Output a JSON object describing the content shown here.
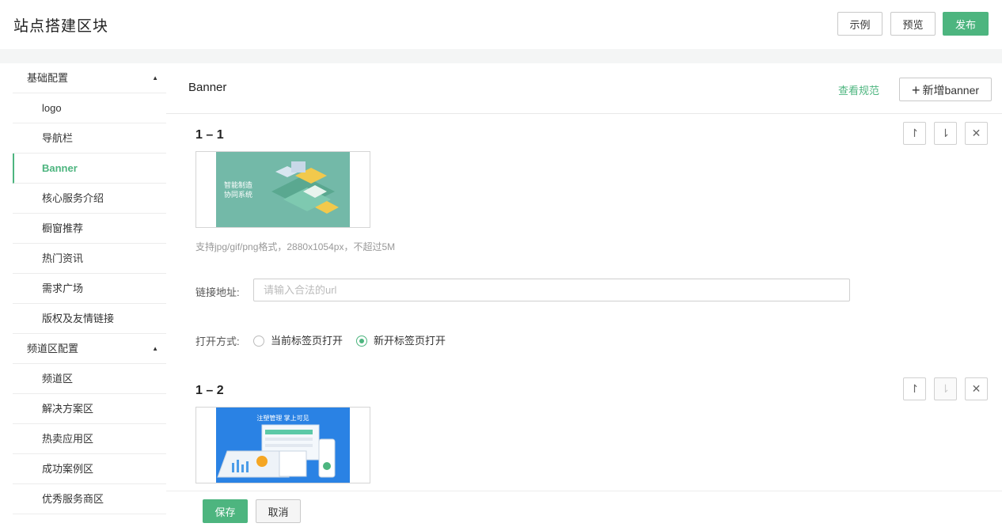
{
  "header": {
    "title": "站点搭建区块",
    "example_label": "示例",
    "preview_label": "预览",
    "publish_label": "发布"
  },
  "sidebar": {
    "groups": [
      {
        "label": "基础配置",
        "arrow": "▲"
      },
      {
        "label": "频道区配置",
        "arrow": "▲"
      }
    ],
    "items": [
      {
        "label": "logo"
      },
      {
        "label": "导航栏"
      },
      {
        "label": "Banner"
      },
      {
        "label": "核心服务介绍"
      },
      {
        "label": "橱窗推荐"
      },
      {
        "label": "热门资讯"
      },
      {
        "label": "需求广场"
      },
      {
        "label": "版权及友情链接"
      },
      {
        "label": "频道区"
      },
      {
        "label": "解决方案区"
      },
      {
        "label": "热卖应用区"
      },
      {
        "label": "成功案例区"
      },
      {
        "label": "优秀服务商区"
      }
    ]
  },
  "main": {
    "title": "Banner",
    "view_spec_label": "查看规范",
    "add_banner_label": "新增banner",
    "banners": [
      {
        "index_label": "1 – 1",
        "image_text_line1": "智能制造",
        "image_text_line2": "协同系统",
        "hint": "支持jpg/gif/png格式，2880x1054px，不超过5M",
        "link_label": "链接地址:",
        "link_placeholder": "请输入合法的url",
        "link_value": "",
        "open_label": "打开方式:",
        "open_options": [
          "当前标签页打开",
          "新开标签页打开"
        ],
        "open_selected": "新开标签页打开"
      },
      {
        "index_label": "1 – 2",
        "image_text": "注塑管理  掌上可见"
      }
    ]
  },
  "footer": {
    "save_label": "保存",
    "cancel_label": "取消"
  },
  "colors": {
    "accent": "#4db57f"
  }
}
